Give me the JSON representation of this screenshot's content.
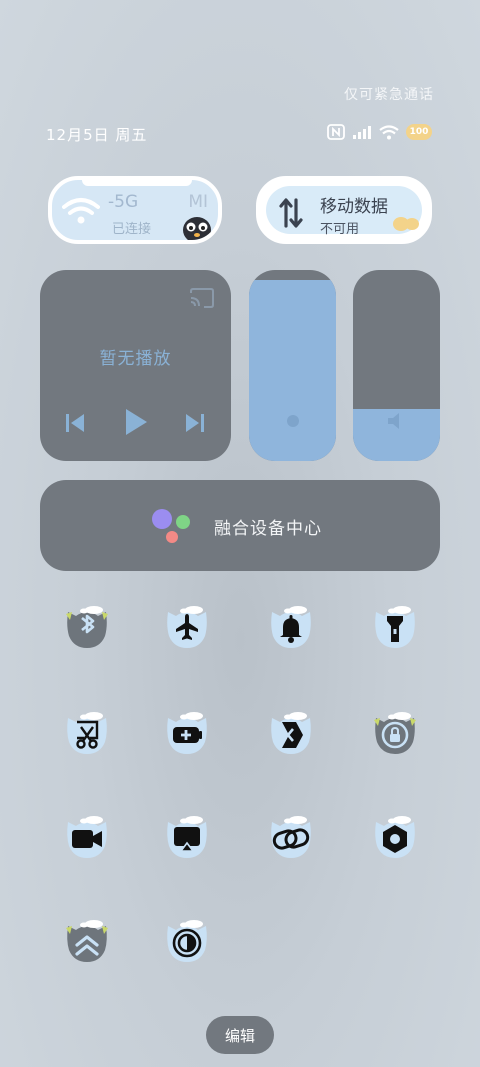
{
  "status_bar": {
    "emergency_text": "仅可紧急通话",
    "date": "12月5日 周五",
    "battery": "100"
  },
  "wifi_card": {
    "main": "-5G",
    "sub": "已连接",
    "extra": "MI"
  },
  "data_card": {
    "title": "移动数据",
    "sub": "不可用"
  },
  "media": {
    "status": "暂无播放"
  },
  "sliders": {
    "brightness_level": 0.95,
    "volume_level": 0.27
  },
  "fusion": {
    "label": "融合设备中心"
  },
  "tiles": [
    {
      "icon": "bluetooth-icon",
      "active": false
    },
    {
      "icon": "airplane-icon",
      "active": true
    },
    {
      "icon": "bell-icon",
      "active": true
    },
    {
      "icon": "flashlight-icon",
      "active": true
    },
    {
      "icon": "screenshot-scissors-icon",
      "active": true
    },
    {
      "icon": "battery-saver-icon",
      "active": true
    },
    {
      "icon": "nfc-share-icon",
      "active": true
    },
    {
      "icon": "rotation-lock-icon",
      "active": false
    },
    {
      "icon": "video-camera-icon",
      "active": true
    },
    {
      "icon": "screen-cast-icon",
      "active": true
    },
    {
      "icon": "link-icon",
      "active": true
    },
    {
      "icon": "hexagon-settings-icon",
      "active": true
    },
    {
      "icon": "double-chevron-up-icon",
      "active": false
    },
    {
      "icon": "contrast-icon",
      "active": true
    }
  ],
  "colors": {
    "tile_active": "#c9e1f5",
    "tile_inactive": "#6e757c",
    "slider_fill": "#8fb5dc",
    "card_dark": "#72787f"
  },
  "edit_button": {
    "label": "编辑"
  }
}
